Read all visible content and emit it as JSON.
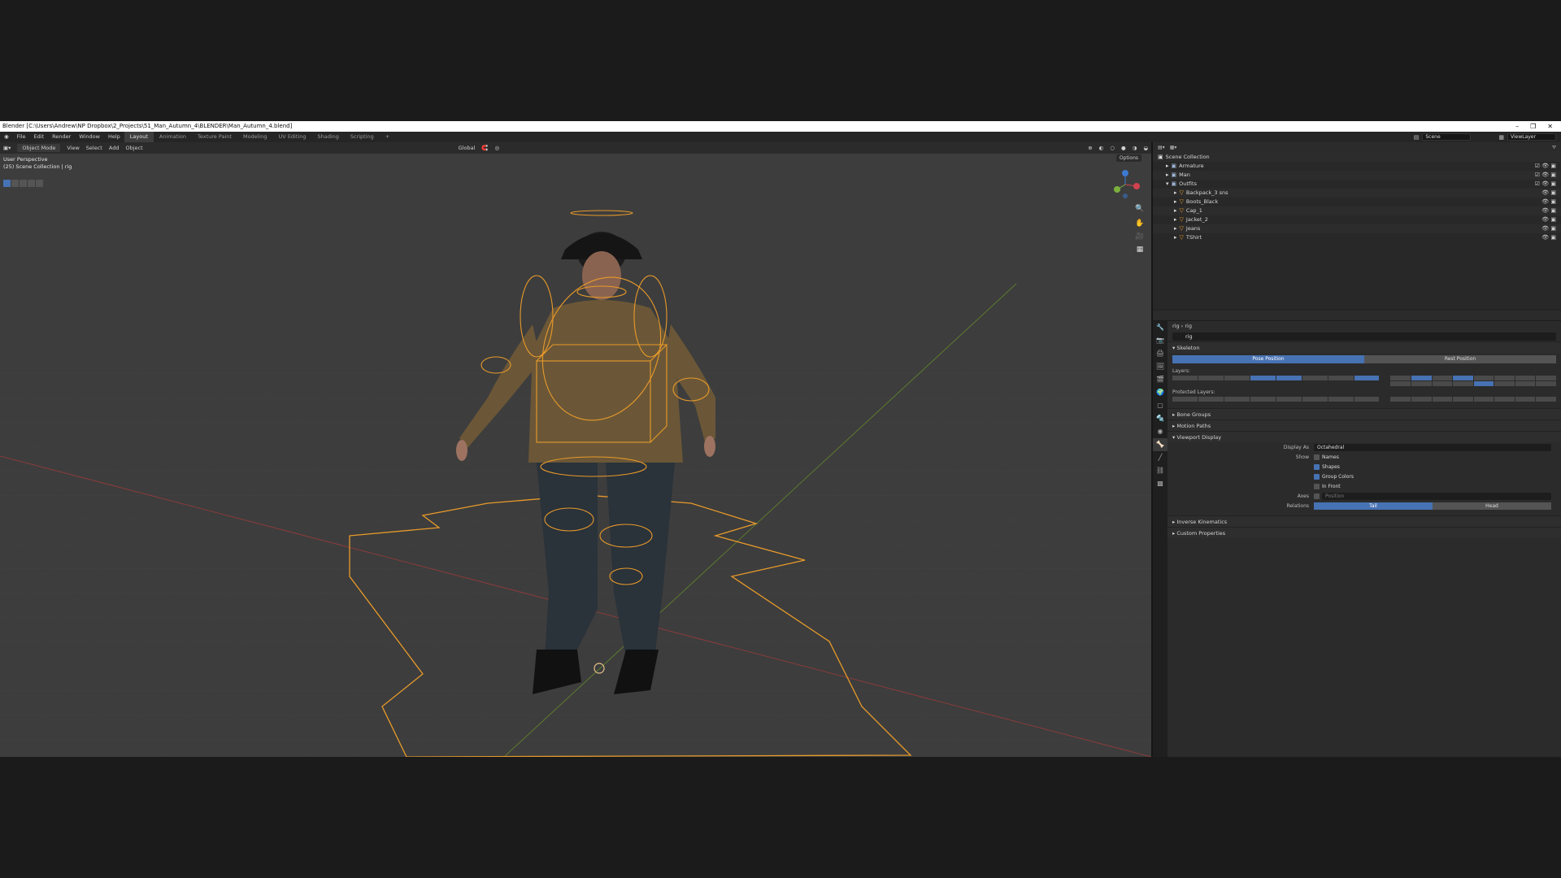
{
  "title": "Blender [C:\\Users\\Andrew\\NP Dropbox\\2_Projects\\51_Man_Autumn_4\\BLENDER\\Man_Autumn_4.blend]",
  "menu": [
    "File",
    "Edit",
    "Render",
    "Window",
    "Help"
  ],
  "workspaces": [
    "Layout",
    "Animation",
    "Texture Paint",
    "Modeling",
    "UV Editing",
    "Shading",
    "Scripting",
    "+"
  ],
  "active_workspace": "Layout",
  "scene": "Scene",
  "view_layer": "ViewLayer",
  "viewport_header": {
    "mode": "Object Mode",
    "menus": [
      "View",
      "Select",
      "Add",
      "Object"
    ],
    "orientation": "Global",
    "options": "Options"
  },
  "viewport_info": {
    "line1": "User Perspective",
    "line2": "(25) Scene Collection | rig"
  },
  "outliner": {
    "root": "Scene Collection",
    "items": [
      {
        "name": "Armature",
        "indent": 1
      },
      {
        "name": "Man",
        "indent": 1
      },
      {
        "name": "Outfits",
        "indent": 1
      },
      {
        "name": "Backpack_3 sns",
        "indent": 2
      },
      {
        "name": "Boots_Black",
        "indent": 2
      },
      {
        "name": "Cap_1",
        "indent": 2
      },
      {
        "name": "Jacket_2",
        "indent": 2
      },
      {
        "name": "Jeans",
        "indent": 2
      },
      {
        "name": "TShirt",
        "indent": 2
      }
    ]
  },
  "properties": {
    "breadcrumb": "rig  ›  rig",
    "name": "rig",
    "skeleton": "Skeleton",
    "pose_position": "Pose Position",
    "rest_position": "Rest Position",
    "layers": "Layers:",
    "protected_layers": "Protected Layers:",
    "bone_groups": "Bone Groups",
    "motion_paths": "Motion Paths",
    "viewport_display": "Viewport Display",
    "display_as_label": "Display As",
    "display_as_value": "Octahedral",
    "show_label": "Show",
    "names": "Names",
    "shapes": "Shapes",
    "group_colors": "Group Colors",
    "in_front": "In Front",
    "axes_label": "Axes",
    "axes_value": "Position",
    "relations_label": "Relations",
    "tail": "Tail",
    "head": "Head",
    "inverse_kinematics": "Inverse Kinematics",
    "custom_properties": "Custom Properties"
  },
  "colors": {
    "accent": "#4772b3",
    "selection": "#e89a2a"
  }
}
